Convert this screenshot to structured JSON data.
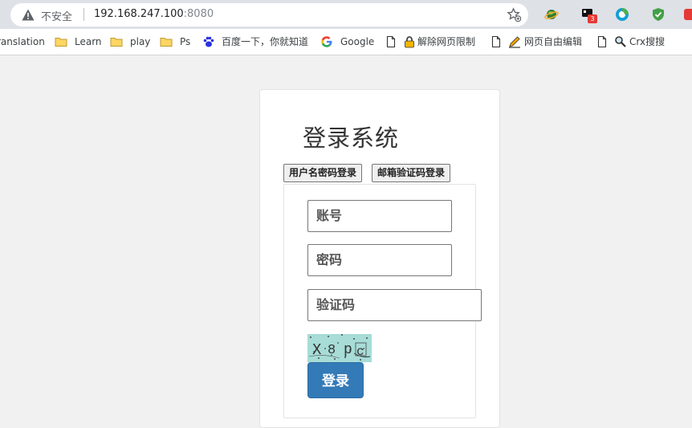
{
  "browser": {
    "security_label": "不安全",
    "url_host": "192.168.247.100",
    "url_port": ":8080",
    "extension_badge": "3",
    "bookmarks": [
      {
        "label": "ranslation",
        "icon": "none"
      },
      {
        "label": "Learn",
        "icon": "folder-icon"
      },
      {
        "label": "play",
        "icon": "folder-icon"
      },
      {
        "label": "Ps",
        "icon": "folder-icon"
      },
      {
        "label": "百度一下，你就知道",
        "icon": "baidu-paw-icon"
      },
      {
        "label": "Google",
        "icon": "google-icon"
      },
      {
        "label": "解除网页限制",
        "icon": "page-lock-icon"
      },
      {
        "label": "网页自由编辑",
        "icon": "page-edit-icon"
      },
      {
        "label": "Crx搜搜",
        "icon": "page-search-icon"
      }
    ]
  },
  "page": {
    "title": "登录系统",
    "tabs": [
      "用户名密码登录",
      "邮箱验证码登录"
    ],
    "fields": {
      "username_placeholder": "账号",
      "password_placeholder": "密码",
      "captcha_placeholder": "验证码"
    },
    "captcha_text": "X8pc",
    "login_label": "登录"
  },
  "colors": {
    "login_button": "#337ab7",
    "captcha_bg": "#a7dcd7",
    "page_bg": "#f1f1f1"
  }
}
